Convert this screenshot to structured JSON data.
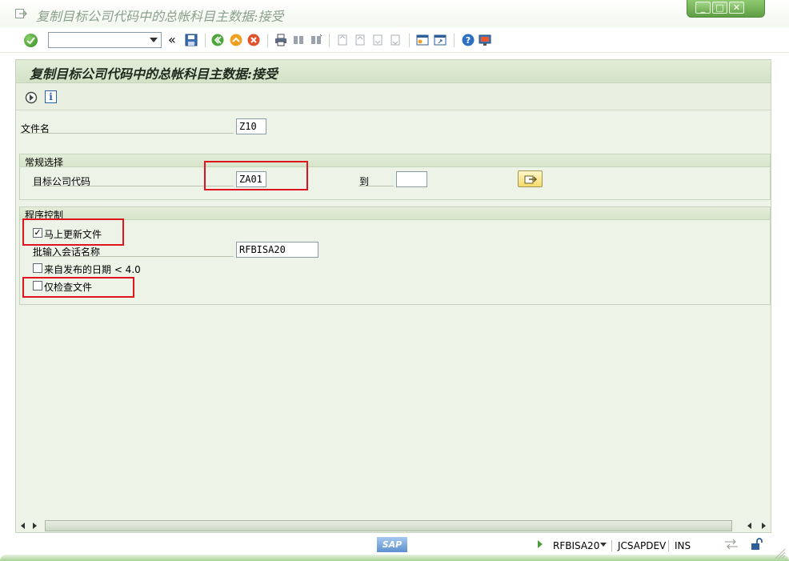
{
  "window": {
    "title": "复制目标公司代码中的总帐科目主数据:接受",
    "controls": [
      "_",
      "□",
      "✕"
    ]
  },
  "toolbar": {
    "command_field_value": "",
    "more_label": "«"
  },
  "screen": {
    "title": "复制目标公司代码中的总帐科目主数据:接受"
  },
  "form": {
    "file_name_label": "文件名",
    "file_name_value": "Z10",
    "general_selection": {
      "title": "常规选择",
      "target_company_code_label": "目标公司代码",
      "target_company_code_value": "ZA01",
      "to_label": "到",
      "to_value": ""
    },
    "program_control": {
      "title": "程序控制",
      "update_immediately_label": "马上更新文件",
      "update_immediately_checked": true,
      "batch_session_label": "批输入会话名称",
      "batch_session_value": "RFBISA20",
      "from_release_label": "来自发布的日期 < 4.0",
      "from_release_checked": false,
      "check_file_only_label": "仅检查文件",
      "check_file_only_checked": false
    }
  },
  "status": {
    "program": "RFBISA20",
    "system": "JCSAPDEV",
    "mode": "INS",
    "logo": "SAP"
  },
  "colors": {
    "highlight_box": "#e0141e",
    "panel_background": "#eef3e8"
  }
}
